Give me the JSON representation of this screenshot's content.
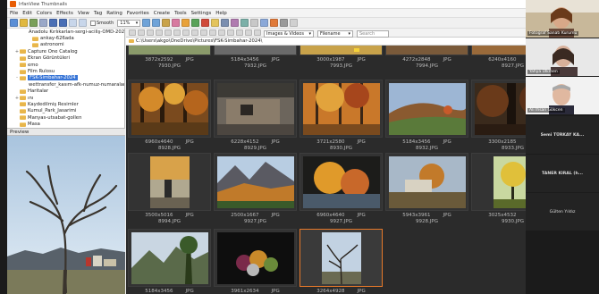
{
  "window": {
    "title": "IrfanView Thumbnails"
  },
  "menu": [
    "File",
    "Edit",
    "Colors",
    "Effects",
    "View",
    "Tag",
    "Rating",
    "Favorites",
    "Create",
    "Tools",
    "Settings",
    "Help"
  ],
  "toolbar": {
    "smooth_label": "Smooth",
    "zoom_value": "11%",
    "filter_value": "Images & Videos",
    "sort_value": "Filename",
    "search_placeholder": "Search"
  },
  "path": "C:\\Users\\akgo\\OneDrive\\Pictures\\FSK-Simbahar-2024\\",
  "folder_tree": [
    {
      "label": "Anadolu Kırlıkarları-sergi-aciliş-OMD-2023",
      "level": 2,
      "expand": ""
    },
    {
      "label": "ankay-626ada",
      "level": 2,
      "expand": ""
    },
    {
      "label": "astronomi",
      "level": 2,
      "expand": ""
    },
    {
      "label": "Capture One Catalog",
      "level": 1,
      "expand": "+"
    },
    {
      "label": "Ekran Görüntüleri",
      "level": 1,
      "expand": ""
    },
    {
      "label": "emo",
      "level": 1,
      "expand": ""
    },
    {
      "label": "Film Rulosu",
      "level": 1,
      "expand": ""
    },
    {
      "label": "FSK-Simbahar-2024",
      "level": 1,
      "expand": "-",
      "selected": true
    },
    {
      "label": "wettransfer_kasım-afk-numuz-numaralar",
      "level": 2,
      "expand": ""
    },
    {
      "label": "Haritalar",
      "level": 1,
      "expand": ""
    },
    {
      "label": "ını",
      "level": 1,
      "expand": "+"
    },
    {
      "label": "Kaydedilmiş Resimler",
      "level": 1,
      "expand": ""
    },
    {
      "label": "Kumul_Park_Jasarimi",
      "level": 1,
      "expand": ""
    },
    {
      "label": "Manyas-utsabat-gollen",
      "level": 1,
      "expand": ""
    },
    {
      "label": "Masa",
      "level": 1,
      "expand": ""
    }
  ],
  "preview_label": "Preview",
  "thumbnails_top": [
    {
      "dims": "3872x2592",
      "type": "JPG",
      "name": "7930.JPG"
    },
    {
      "dims": "5184x3456",
      "type": "JPG",
      "name": "7932.JPG"
    },
    {
      "dims": "3000x1987",
      "type": "JPG",
      "name": "7993.JPG"
    },
    {
      "dims": "4272x2848",
      "type": "JPG",
      "name": "7994.JPG"
    },
    {
      "dims": "6240x4160",
      "type": "JPG",
      "name": "8927.JPG"
    }
  ],
  "thumbnails_row2": [
    {
      "dims": "6960x4640",
      "type": "JPG",
      "name": "8928.JPG"
    },
    {
      "dims": "6228x4152",
      "type": "JPG",
      "name": "8929.JPG"
    },
    {
      "dims": "3721x2580",
      "type": "JPG",
      "name": "8930.JPG"
    },
    {
      "dims": "5184x3456",
      "type": "JPG",
      "name": "8932.JPG"
    },
    {
      "dims": "3300x2185",
      "type": "JPG",
      "name": "8933.JPG"
    }
  ],
  "thumbnails_row3": [
    {
      "dims": "3500x5016",
      "type": "JPG",
      "name": "8994.JPG"
    },
    {
      "dims": "2500x1667",
      "type": "JPG",
      "name": "9927.JPG"
    },
    {
      "dims": "6960x4640",
      "type": "JPG",
      "name": "9927.JPG"
    },
    {
      "dims": "5943x3961",
      "type": "JPG",
      "name": "9928.JPG"
    },
    {
      "dims": "3025x4532",
      "type": "JPG",
      "name": "9930.JPG"
    }
  ],
  "thumbnails_row4": [
    {
      "dims": "5184x3456",
      "type": "JPG",
      "name": ""
    },
    {
      "dims": "3961x2634",
      "type": "JPG",
      "name": ""
    },
    {
      "dims": "3264x4928",
      "type": "JPG",
      "name": ""
    }
  ],
  "participants": [
    {
      "name": "Fotoğraf Sanatı Kurumu",
      "kind": "video"
    },
    {
      "name": "Yahya Ülkmen",
      "kind": "video"
    },
    {
      "name": "Ali İhsan Gökcen",
      "kind": "video"
    },
    {
      "name": "Semi TÜRKAY KA...",
      "kind": "name"
    },
    {
      "name": "TANER KIRAL (h...",
      "kind": "name"
    },
    {
      "name": "Gülten Yıldız",
      "kind": "name-light"
    }
  ]
}
